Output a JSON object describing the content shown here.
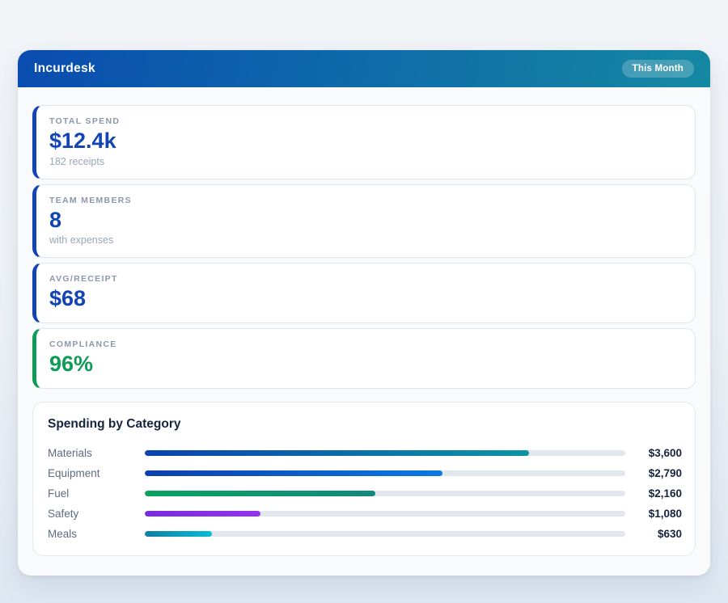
{
  "app": {
    "title": "Incurdesk",
    "period_badge": "This Month",
    "header_gradient": [
      "#0a4cb0",
      "#1489a2"
    ]
  },
  "stats": [
    {
      "label": "TOTAL SPEND",
      "value": "$12.4k",
      "sub": "182 receipts",
      "accent": "#1244b2"
    },
    {
      "label": "TEAM MEMBERS",
      "value": "8",
      "sub": "with expenses",
      "accent": "#1244b2"
    },
    {
      "label": "AVG/RECEIPT",
      "value": "$68",
      "sub": "",
      "accent": "#1244b2"
    },
    {
      "label": "COMPLIANCE",
      "value": "96%",
      "sub": "",
      "accent": "#0d9b57"
    }
  ],
  "chart_data": {
    "type": "bar",
    "title": "Spending by Category",
    "categories": [
      "Materials",
      "Equipment",
      "Fuel",
      "Safety",
      "Meals"
    ],
    "values": [
      3600,
      2790,
      2160,
      1080,
      630
    ],
    "value_labels": [
      "$3,600",
      "$2,790",
      "$2,160",
      "$1,080",
      "$630"
    ],
    "percents": [
      80,
      62,
      48,
      24,
      14
    ],
    "xlim": [
      0,
      4500
    ],
    "orientation": "horizontal",
    "track_color": "#e2e7ee",
    "bar_gradients": [
      [
        "#0b41ad",
        "#0b94a3"
      ],
      [
        "#0c3fae",
        "#0b79e0"
      ],
      [
        "#0ba35f",
        "#12887d"
      ],
      [
        "#7a2be0",
        "#9333ea"
      ],
      [
        "#0e7fa0",
        "#08bcd8"
      ]
    ]
  }
}
